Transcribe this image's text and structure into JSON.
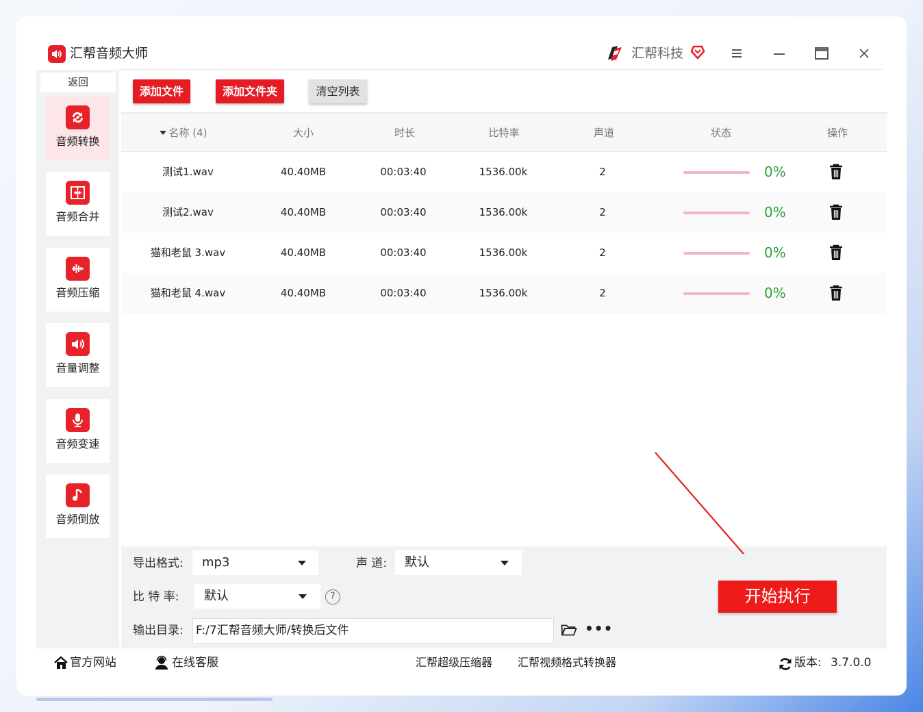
{
  "app": {
    "title": "汇帮音频大师",
    "brand": "汇帮科技"
  },
  "window_controls": [
    "menu-icon",
    "minimize-icon",
    "maximize-icon",
    "close-icon"
  ],
  "sidebar": {
    "back_label": "返回",
    "items": [
      {
        "label": "音频转换",
        "icon": "audio-convert-icon",
        "active": true
      },
      {
        "label": "音频合并",
        "icon": "audio-merge-icon",
        "active": false
      },
      {
        "label": "音频压缩",
        "icon": "audio-compress-icon",
        "active": false
      },
      {
        "label": "音量调整",
        "icon": "volume-icon",
        "active": false
      },
      {
        "label": "音频变速",
        "icon": "microphone-icon",
        "active": false
      },
      {
        "label": "音频倒放",
        "icon": "music-note-icon",
        "active": false
      }
    ]
  },
  "toolbar": {
    "add_file": "添加文件",
    "add_folder": "添加文件夹",
    "clear_list": "清空列表"
  },
  "table": {
    "headers": {
      "name": "名称 (4)",
      "size": "大小",
      "duration": "时长",
      "bitrate": "比特率",
      "channels": "声道",
      "status": "状态",
      "action": "操作"
    },
    "rows": [
      {
        "name": "测试1.wav",
        "size": "40.40MB",
        "duration": "00:03:40",
        "bitrate": "1536.00k",
        "channels": "2",
        "progress": "0%"
      },
      {
        "name": "测试2.wav",
        "size": "40.40MB",
        "duration": "00:03:40",
        "bitrate": "1536.00k",
        "channels": "2",
        "progress": "0%"
      },
      {
        "name": "猫和老鼠 3.wav",
        "size": "40.40MB",
        "duration": "00:03:40",
        "bitrate": "1536.00k",
        "channels": "2",
        "progress": "0%"
      },
      {
        "name": "猫和老鼠 4.wav",
        "size": "40.40MB",
        "duration": "00:03:40",
        "bitrate": "1536.00k",
        "channels": "2",
        "progress": "0%"
      }
    ]
  },
  "settings": {
    "format_label": "导出格式:",
    "format_value": "mp3",
    "channel_label": "声 道:",
    "channel_value": "默认",
    "bitrate_label": "比 特 率:",
    "bitrate_value": "默认",
    "help_symbol": "?",
    "dir_label": "输出目录:",
    "dir_value": "F:/7汇帮音频大师/转换后文件",
    "more_symbol": "•••",
    "start_label": "开始执行"
  },
  "footer": {
    "website": "官方网站",
    "support": "在线客服",
    "link1": "汇帮超级压缩器",
    "link2": "汇帮视频格式转换器",
    "version_label": "版本:",
    "version": "3.7.0.0"
  },
  "colors": {
    "accent": "#e51c23",
    "progress_track": "#f3b6c3",
    "progress_text": "#2ba13a",
    "sidebar_bg": "#f1f2f4",
    "active_nav": "#fce6e8"
  }
}
